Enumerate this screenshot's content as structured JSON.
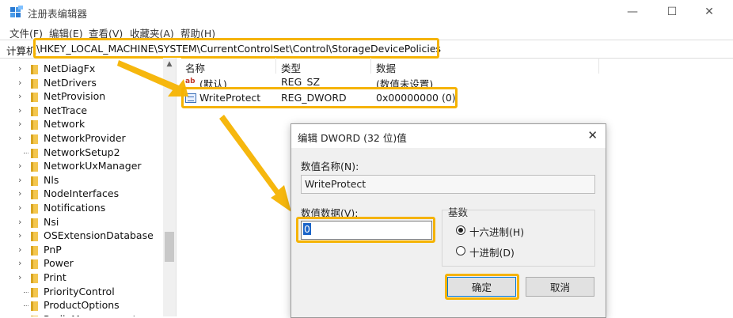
{
  "window": {
    "title": "注册表编辑器",
    "minimize_glyph": "—",
    "maximize_glyph": "☐",
    "close_glyph": "✕"
  },
  "menu": [
    "文件(F)",
    "编辑(E)",
    "查看(V)",
    "收藏夹(A)",
    "帮助(H)"
  ],
  "address": {
    "label": "计算机",
    "path": "\\HKEY_LOCAL_MACHINE\\SYSTEM\\CurrentControlSet\\Control\\StorageDevicePolicies"
  },
  "tree": {
    "items": [
      "NetDiagFx",
      "NetDrivers",
      "NetProvision",
      "NetTrace",
      "Network",
      "NetworkProvider",
      "NetworkSetup2",
      "NetworkUxManager",
      "Nls",
      "NodeInterfaces",
      "Notifications",
      "Nsi",
      "OSExtensionDatabase",
      "PnP",
      "Power",
      "Print",
      "PriorityControl",
      "ProductOptions",
      "RadioManagement"
    ]
  },
  "list": {
    "headers": {
      "name": "名称",
      "type": "类型",
      "data": "数据"
    },
    "rows": [
      {
        "name": "(默认)",
        "type": "REG_SZ",
        "data": "(数值未设置)"
      },
      {
        "name": "WriteProtect",
        "type": "REG_DWORD",
        "data": "0x00000000 (0)"
      }
    ]
  },
  "dialog": {
    "title": "编辑 DWORD (32 位)值",
    "close_glyph": "✕",
    "name_label": "数值名称(N):",
    "name_value": "WriteProtect",
    "data_label": "数值数据(V):",
    "data_value": "0",
    "base_label": "基数",
    "radio_hex": "十六进制(H)",
    "radio_dec": "十进制(D)",
    "ok": "确定",
    "cancel": "取消"
  },
  "colors": {
    "highlight": "#f5b301",
    "selection": "#1a64c8"
  }
}
